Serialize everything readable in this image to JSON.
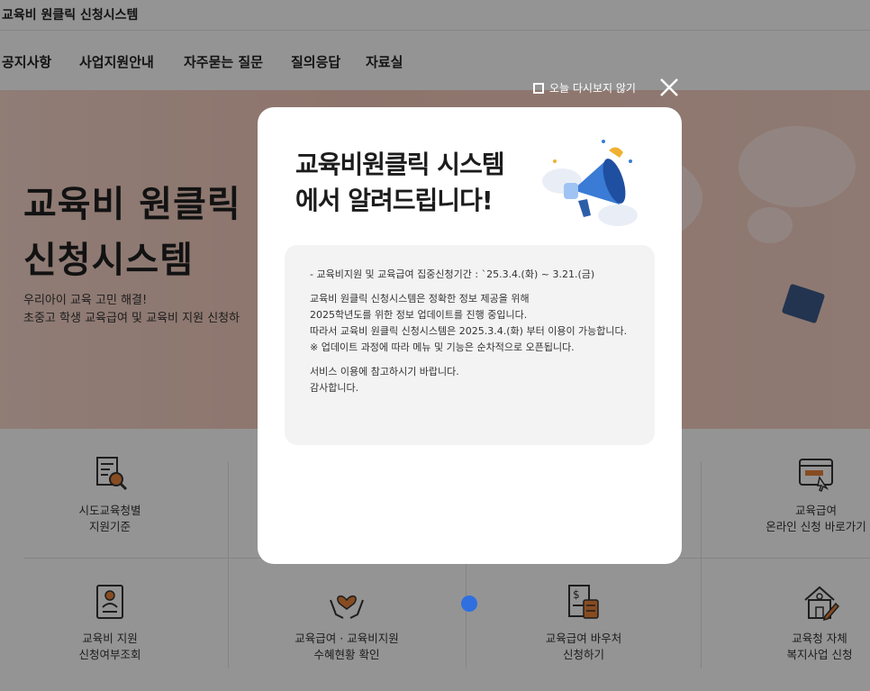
{
  "header": {
    "site_title": "교육비 원클릭 신청시스템",
    "nav": [
      "공지사항",
      "사업지원안내",
      "자주묻는 질문",
      "질의응답",
      "자료실"
    ]
  },
  "hero": {
    "title_line1": "교육비 원클릭",
    "title_line2": "신청시스템",
    "sub1": "우리아이 교육 고민 해결!",
    "sub2": "초중고 학생 교육급여 및 교육비 지원 신청하"
  },
  "quick_menu": {
    "row1": [
      {
        "line1": "시도교육청별",
        "line2": "지원기준",
        "icon": "document-search-icon"
      },
      {
        "line1": "교육급여",
        "line2": "온라인 신청 바로가기",
        "icon": "web-click-icon"
      }
    ],
    "row2": [
      {
        "line1": "교육비 지원",
        "line2": "신청여부조회",
        "icon": "check-person-icon"
      },
      {
        "line1": "교육급여 · 교육비지원",
        "line2": "수혜현황 확인",
        "icon": "hands-heart-icon"
      },
      {
        "line1": "교육급여 바우처",
        "line2": "신청하기",
        "icon": "bill-calculator-icon"
      },
      {
        "line1": "교육청 자체",
        "line2": "복지사업 신청",
        "icon": "house-pen-icon"
      }
    ]
  },
  "popup": {
    "not_today_label": "오늘 다시보지 않기",
    "heading_line1": "교육비원클릭 시스템",
    "heading_line2": "에서 알려드립니다!",
    "notice": {
      "period": "- 교육비지원 및 교육급여 집중신청기간 : `25.3.4.(화) ~ 3.21.(금)",
      "p1_l1": "교육비 원클릭 신청시스템은 정확한 정보 제공을 위해",
      "p1_l2": "2025학년도를 위한 정보 업데이트를 진행 중입니다.",
      "p1_l3": "따라서 교육비 원클릭 신청시스템은 2025.3.4.(화) 부터 이용이 가능합니다.",
      "p1_l4": "※ 업데이트 과정에 따라 메뉴 및 기능은 순차적으로 오픈됩니다.",
      "p2_l1": "서비스 이용에 참고하시기 바랍니다.",
      "p2_l2": "감사합니다."
    }
  },
  "colors": {
    "hero_bg": "#f3c9ba",
    "accent_dot": "#2f6fe0",
    "icon_orange": "#e8833a"
  }
}
